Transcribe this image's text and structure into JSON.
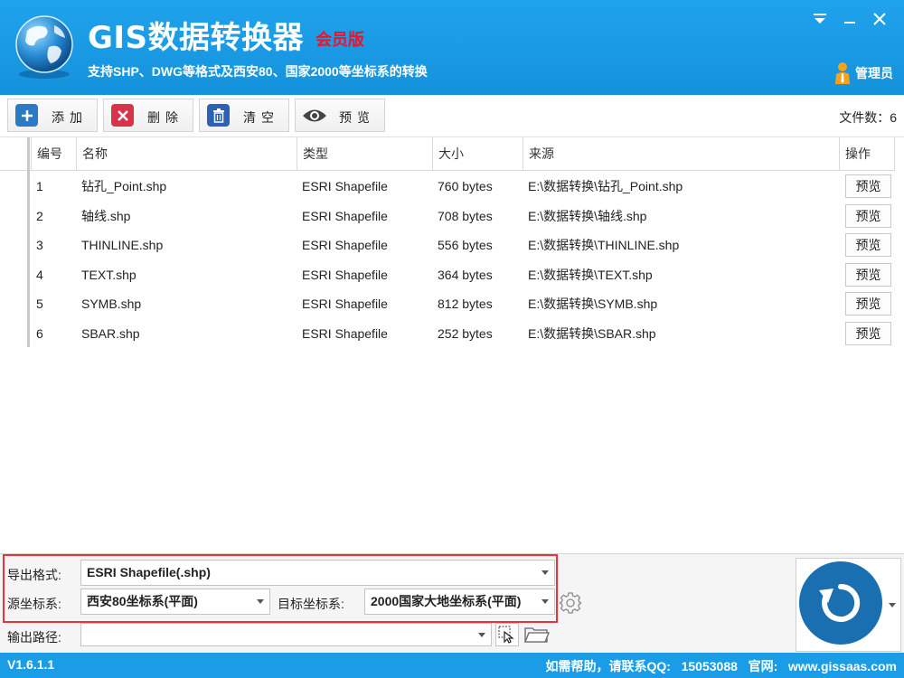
{
  "header": {
    "app_title": "GIS数据转换器",
    "edition": "会员版",
    "subtitle": "支持SHP、DWG等格式及西安80、国家2000等坐标系的转换",
    "admin_label": "管理员",
    "colors": {
      "header_bg": "#1fa3ec",
      "edition": "#e8152d",
      "status_bg": "#1a9de6"
    }
  },
  "window_controls": {
    "icons": [
      "menu-dropdown-icon",
      "minimize-icon",
      "close-icon"
    ]
  },
  "toolbar": {
    "add_label": "添加",
    "delete_label": "删除",
    "clear_label": "清空",
    "preview_label": "预览",
    "file_count_label": "文件数：",
    "file_count": "6"
  },
  "table": {
    "columns": [
      "编号",
      "名称",
      "类型",
      "大小",
      "来源",
      "操作"
    ],
    "rows": [
      {
        "no": "1",
        "name": "钻孔_Point.shp",
        "type": "ESRI Shapefile",
        "size": "760 bytes",
        "source": "E:\\数据转换\\钻孔_Point.shp",
        "action": "预览"
      },
      {
        "no": "2",
        "name": "轴线.shp",
        "type": "ESRI Shapefile",
        "size": "708 bytes",
        "source": "E:\\数据转换\\轴线.shp",
        "action": "预览"
      },
      {
        "no": "3",
        "name": "THINLINE.shp",
        "type": "ESRI Shapefile",
        "size": "556 bytes",
        "source": "E:\\数据转换\\THINLINE.shp",
        "action": "预览"
      },
      {
        "no": "4",
        "name": "TEXT.shp",
        "type": "ESRI Shapefile",
        "size": "364 bytes",
        "source": "E:\\数据转换\\TEXT.shp",
        "action": "预览"
      },
      {
        "no": "5",
        "name": "SYMB.shp",
        "type": "ESRI Shapefile",
        "size": "812 bytes",
        "source": "E:\\数据转换\\SYMB.shp",
        "action": "预览"
      },
      {
        "no": "6",
        "name": "SBAR.shp",
        "type": "ESRI Shapefile",
        "size": "252 bytes",
        "source": "E:\\数据转换\\SBAR.shp",
        "action": "预览"
      }
    ]
  },
  "settings": {
    "export_format_label": "导出格式:",
    "export_format_value": "ESRI Shapefile(.shp)",
    "source_crs_label": "源坐标系:",
    "source_crs_value": "西安80坐标系(平面)",
    "target_crs_label": "目标坐标系:",
    "target_crs_value": "2000国家大地坐标系(平面)",
    "output_path_label": "输出路径:",
    "output_path_value": ""
  },
  "status": {
    "version": "V1.6.1.1",
    "help_text": "如需帮助，请联系QQ:   15053088   官网:   www.gissaas.com"
  }
}
